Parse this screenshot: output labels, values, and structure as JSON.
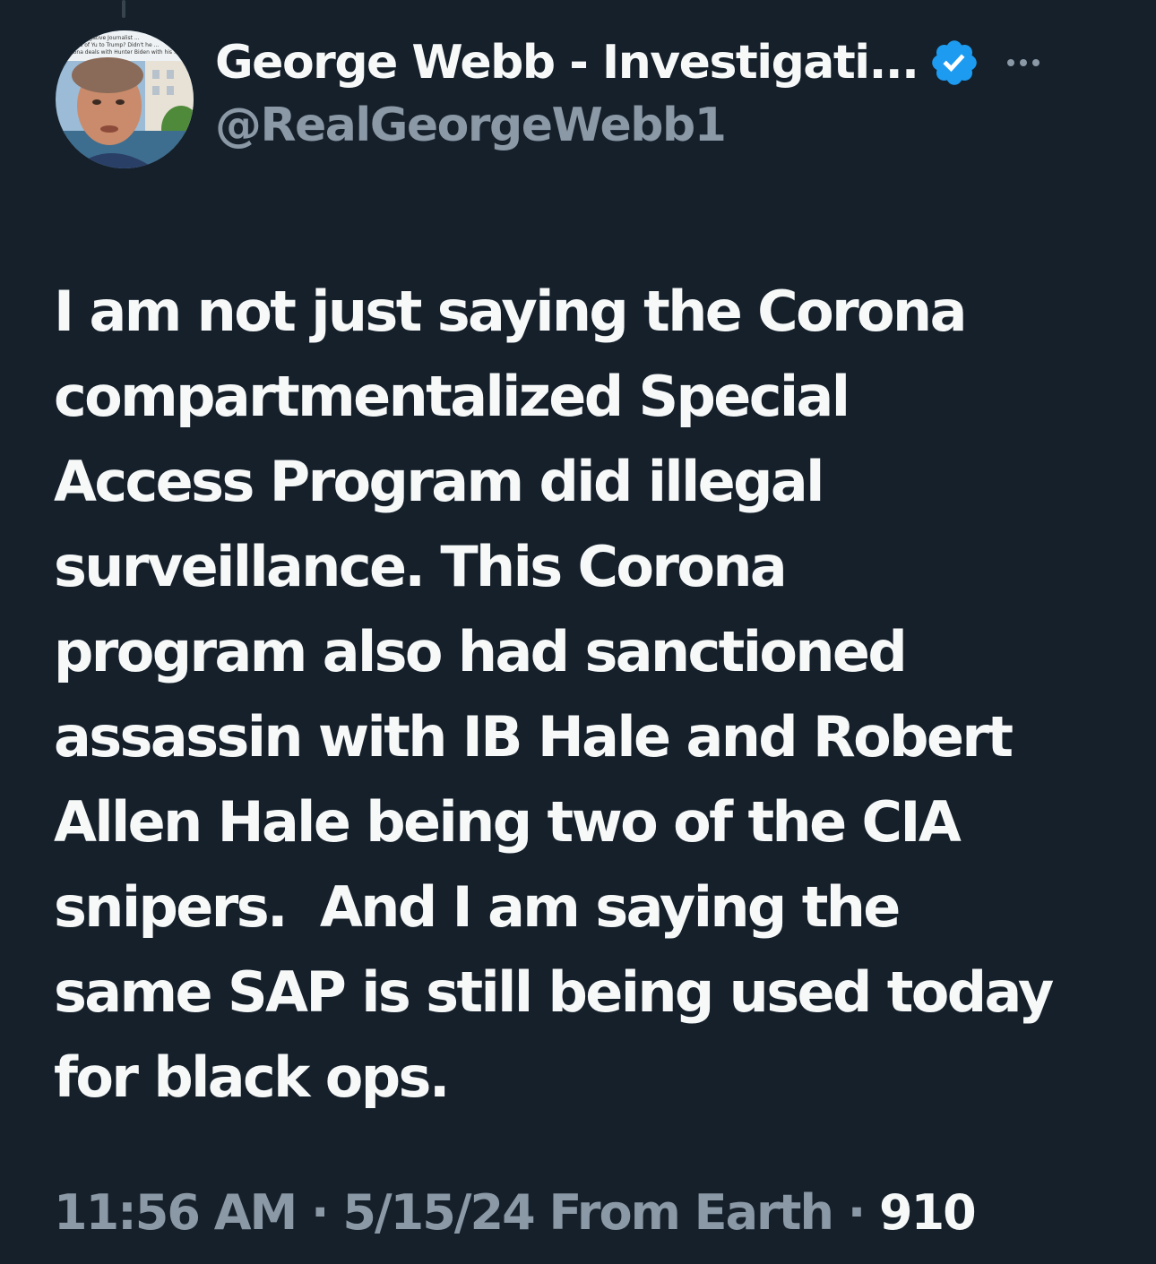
{
  "author": {
    "display_name": "George Webb - Investigati...",
    "handle": "@RealGeorgeWebb1",
    "verified": true,
    "avatar_icon": "profile-photo",
    "avatar_overlay_text": [
      "...igative Journalist ...",
      "...ons of Yu to Trump?  Didn't he ...",
      "...orona deals with Hunter Biden with his ..."
    ]
  },
  "more_icon": "ellipsis-icon",
  "tweet": {
    "lines": [
      "I am not just saying the Corona",
      "compartmentalized Special",
      "Access Program did illegal",
      "surveillance. This Corona",
      "program also had sanctioned",
      "assassin with IB Hale and Robert",
      "Allen Hale being two of the CIA",
      "snipers.  And I am saying the",
      "same SAP is still being used today",
      "for black ops."
    ]
  },
  "meta": {
    "time": "11:56 AM",
    "separator": " · ",
    "date": "5/15/24",
    "source": " From Earth",
    "count": "910"
  },
  "colors": {
    "background": "#15202b",
    "text_primary": "#f7f9f9",
    "text_secondary": "#8b98a5",
    "verified_blue": "#1d9bf0"
  }
}
